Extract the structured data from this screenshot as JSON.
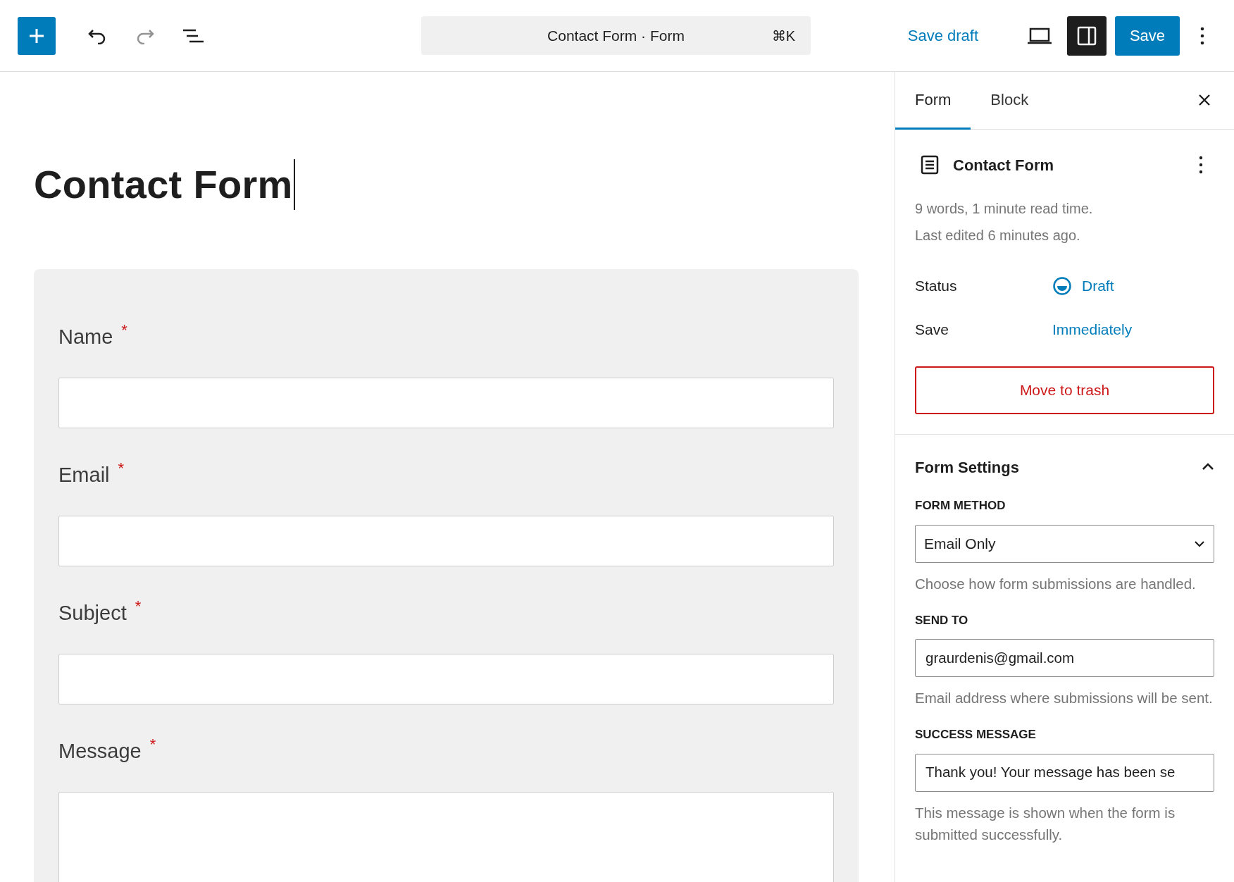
{
  "toolbar": {
    "buttons": [
      {
        "kind": "inserter",
        "disabled": false
      },
      {
        "kind": "undo",
        "disabled": false
      },
      {
        "kind": "redo",
        "disabled": true
      },
      {
        "kind": "list-view",
        "disabled": false
      }
    ],
    "command_bar": {
      "title": "Contact Form · Form",
      "shortcut": "⌘K"
    },
    "save_draft": "Save draft",
    "sidebar_toggle_on": true,
    "save": "Save"
  },
  "editor": {
    "title": "Contact Form",
    "fields": [
      {
        "label": "Name",
        "required_mark": "*",
        "kind": "text"
      },
      {
        "label": "Email",
        "required_mark": "*",
        "kind": "text"
      },
      {
        "label": "Subject",
        "required_mark": "*",
        "kind": "text"
      },
      {
        "label": "Message",
        "required_mark": "*",
        "kind": "textarea"
      }
    ]
  },
  "sidebar": {
    "tabs": [
      {
        "label": "Form",
        "selected": true
      },
      {
        "label": "Block",
        "selected": false
      }
    ],
    "summary": {
      "title": "Contact Form",
      "info": [
        "9 words, 1 minute read time.",
        "Last edited 6 minutes ago."
      ],
      "rows": [
        {
          "label": "Status",
          "value": "Draft",
          "kind": "status"
        },
        {
          "label": "Save",
          "value": "Immediately",
          "kind": "link"
        }
      ],
      "trash": "Move to trash"
    },
    "form_settings": {
      "title": "Form Settings",
      "expanded": true,
      "form_method": {
        "label": "FORM METHOD",
        "value": "Email Only",
        "help": "Choose how form submissions are handled."
      },
      "send_to": {
        "label": "SEND TO",
        "value": "graurdenis@gmail.com",
        "help": "Email address where submissions will be sent."
      },
      "success_message": {
        "label": "SUCCESS MESSAGE",
        "value": "Thank you! Your message has been se",
        "help": "This message is shown when the form is submitted successfully."
      }
    }
  }
}
